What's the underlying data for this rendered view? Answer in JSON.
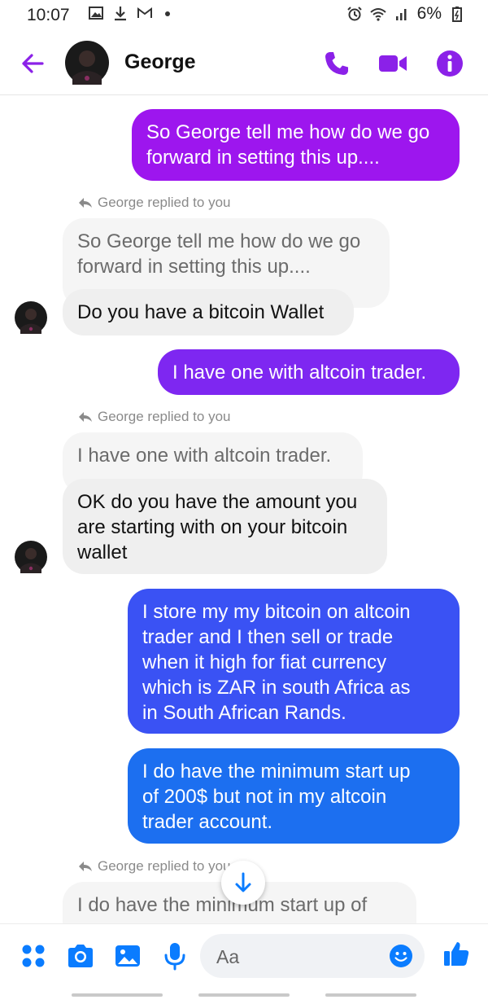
{
  "status_bar": {
    "time": "10:07",
    "battery": "6%",
    "icons": [
      "gallery-icon",
      "download-icon",
      "gmail-icon",
      "dot-icon",
      "alarm-icon",
      "wifi-icon",
      "signal-icon",
      "battery-icon"
    ]
  },
  "header": {
    "contact_name": "George",
    "accent_color": "#8b21e8",
    "icons": [
      "back-arrow-icon",
      "phone-icon",
      "video-camera-icon",
      "info-icon"
    ]
  },
  "messages": [
    {
      "type": "outgoing",
      "text": "So George tell me how do we go\nforward in setting this up....",
      "color": "#9d16ee"
    },
    {
      "type": "reply-note",
      "text": "George replied to you"
    },
    {
      "type": "quoted",
      "text": "So George tell me how do we go\nforward in setting this up...."
    },
    {
      "type": "incoming",
      "text": "Do you have a bitcoin Wallet"
    },
    {
      "type": "outgoing",
      "text": "I have one with altcoin trader.",
      "color": "#7e27f1"
    },
    {
      "type": "reply-note",
      "text": "George replied to you"
    },
    {
      "type": "quoted",
      "text": "I have one with altcoin trader."
    },
    {
      "type": "incoming",
      "text": "OK do you have the amount you\nare starting with on your bitcoin\nwallet"
    },
    {
      "type": "outgoing",
      "text": "I store my my bitcoin on altcoin\ntrader and I then sell or trade\nwhen it high  for fiat currency\nwhich is ZAR in south Africa as\nin  South African Rands.",
      "color": "#3a52f4"
    },
    {
      "type": "outgoing",
      "text": "I do have the minimum start up\nof 200$ but not in my altcoin\ntrader account.",
      "color": "#1c6ff0"
    },
    {
      "type": "reply-note",
      "text": "George replied to you"
    },
    {
      "type": "quoted",
      "text": "I do have the minimum start up of"
    }
  ],
  "composer": {
    "placeholder": "Aa",
    "accent_color": "#0a7cff",
    "icons": [
      "menu-dots-icon",
      "camera-icon",
      "image-icon",
      "microphone-icon",
      "emoji-icon",
      "thumbs-up-icon"
    ]
  }
}
